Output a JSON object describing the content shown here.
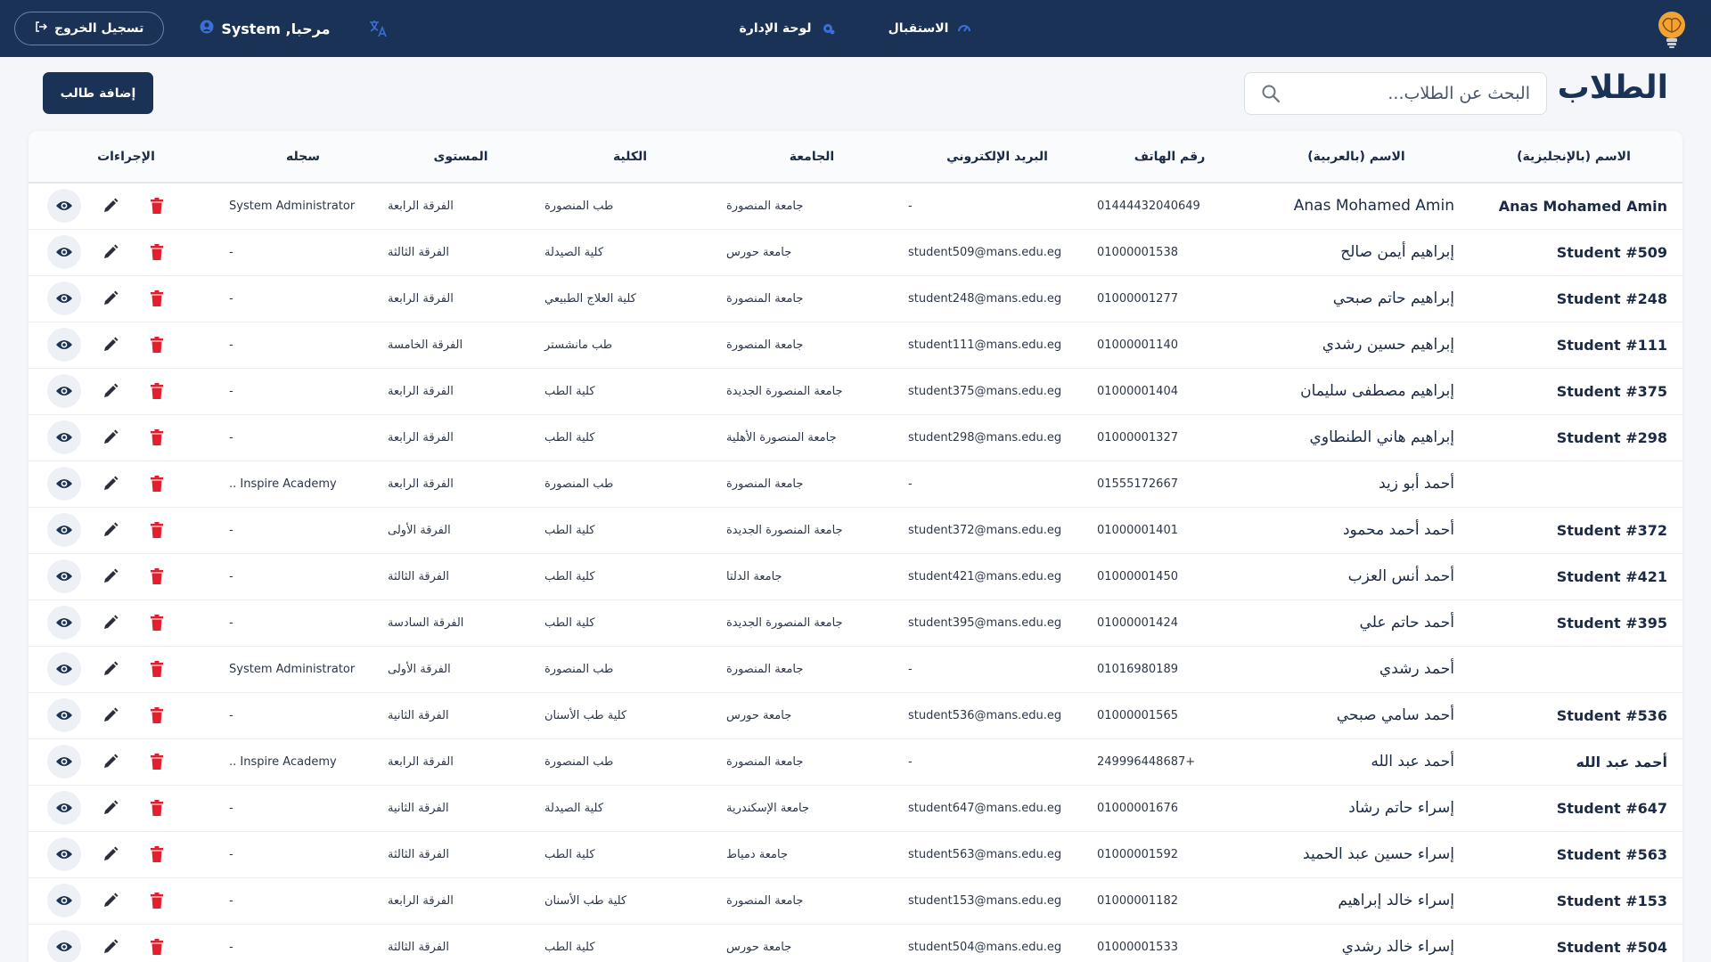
{
  "nav": {
    "home": "الاستقبال",
    "dashboard": "لوحة الإدارة",
    "welcome": "مرحبا, System",
    "logout": "تسجيل الخروج"
  },
  "page": {
    "title": "الطلاب",
    "search_placeholder": "البحث عن الطلاب...",
    "add_label": "إضافة طالب"
  },
  "table": {
    "headers": {
      "name_en": "الاسم (بالإنجليزية)",
      "name_ar": "الاسم (بالعربية)",
      "phone": "رقم الهاتف",
      "email": "البريد الإلكتروني",
      "university": "الجامعة",
      "faculty": "الكلية",
      "level": "المستوى",
      "record": "سجله",
      "actions": "الإجراءات"
    },
    "rows": [
      {
        "name_en": "Anas Mohamed Amin",
        "name_ar": "Anas Mohamed Amin",
        "phone": "01444432040649",
        "email": "-",
        "university": "جامعة المنصورة",
        "faculty": "طب المنصورة",
        "level": "الفرقة الرابعة",
        "record": "System Administrator"
      },
      {
        "name_en": "Student #509",
        "name_ar": "إبراهيم أيمن صالح",
        "phone": "01000001538",
        "email": "student509@mans.edu.eg",
        "university": "جامعة حورس",
        "faculty": "كلية الصيدلة",
        "level": "الفرقة الثالثة",
        "record": "-"
      },
      {
        "name_en": "Student #248",
        "name_ar": "إبراهيم حاتم صبحي",
        "phone": "01000001277",
        "email": "student248@mans.edu.eg",
        "university": "جامعة المنصورة",
        "faculty": "كلية العلاج الطبيعي",
        "level": "الفرقة الرابعة",
        "record": "-"
      },
      {
        "name_en": "Student #111",
        "name_ar": "إبراهيم حسين رشدي",
        "phone": "01000001140",
        "email": "student111@mans.edu.eg",
        "university": "جامعة المنصورة",
        "faculty": "طب مانشستر",
        "level": "الفرقة الخامسة",
        "record": "-"
      },
      {
        "name_en": "Student #375",
        "name_ar": "إبراهيم مصطفى سليمان",
        "phone": "01000001404",
        "email": "student375@mans.edu.eg",
        "university": "جامعة المنصورة الجديدة",
        "faculty": "كلية الطب",
        "level": "الفرقة الرابعة",
        "record": "-"
      },
      {
        "name_en": "Student #298",
        "name_ar": "إبراهيم هاني الطنطاوي",
        "phone": "01000001327",
        "email": "student298@mans.edu.eg",
        "university": "جامعة المنصورة الأهلية",
        "faculty": "كلية الطب",
        "level": "الفرقة الرابعة",
        "record": "-"
      },
      {
        "name_en": "",
        "name_ar": "أحمد أبو زيد",
        "phone": "01555172667",
        "email": "-",
        "university": "جامعة المنصورة",
        "faculty": "طب المنصورة",
        "level": "الفرقة الرابعة",
        "record": "Inspire Academy .."
      },
      {
        "name_en": "Student #372",
        "name_ar": "أحمد أحمد محمود",
        "phone": "01000001401",
        "email": "student372@mans.edu.eg",
        "university": "جامعة المنصورة الجديدة",
        "faculty": "كلية الطب",
        "level": "الفرقة الأولى",
        "record": "-"
      },
      {
        "name_en": "Student #421",
        "name_ar": "أحمد أنس العزب",
        "phone": "01000001450",
        "email": "student421@mans.edu.eg",
        "university": "جامعة الدلتا",
        "faculty": "كلية الطب",
        "level": "الفرقة الثالثة",
        "record": "-"
      },
      {
        "name_en": "Student #395",
        "name_ar": "أحمد حاتم علي",
        "phone": "01000001424",
        "email": "student395@mans.edu.eg",
        "university": "جامعة المنصورة الجديدة",
        "faculty": "كلية الطب",
        "level": "الفرقة السادسة",
        "record": "-"
      },
      {
        "name_en": "",
        "name_ar": "أحمد رشدي",
        "phone": "01016980189",
        "email": "-",
        "university": "جامعة المنصورة",
        "faculty": "طب المنصورة",
        "level": "الفرقة الأولى",
        "record": "System Administrator"
      },
      {
        "name_en": "Student #536",
        "name_ar": "أحمد سامي صبحي",
        "phone": "01000001565",
        "email": "student536@mans.edu.eg",
        "university": "جامعة حورس",
        "faculty": "كلية طب الأسنان",
        "level": "الفرقة الثانية",
        "record": "-"
      },
      {
        "name_en": "أحمد عبد الله",
        "name_ar": "أحمد عبد الله",
        "phone": "+249996448687",
        "email": "-",
        "university": "جامعة المنصورة",
        "faculty": "طب المنصورة",
        "level": "الفرقة الرابعة",
        "record": "Inspire Academy .."
      },
      {
        "name_en": "Student #647",
        "name_ar": "إسراء حاتم رشاد",
        "phone": "01000001676",
        "email": "student647@mans.edu.eg",
        "university": "جامعة الإسكندرية",
        "faculty": "كلية الصيدلة",
        "level": "الفرقة الثانية",
        "record": "-"
      },
      {
        "name_en": "Student #563",
        "name_ar": "إسراء حسين عبد الحميد",
        "phone": "01000001592",
        "email": "student563@mans.edu.eg",
        "university": "جامعة دمياط",
        "faculty": "كلية الطب",
        "level": "الفرقة الثالثة",
        "record": "-"
      },
      {
        "name_en": "Student #153",
        "name_ar": "إسراء خالد إبراهيم",
        "phone": "01000001182",
        "email": "student153@mans.edu.eg",
        "university": "جامعة المنصورة",
        "faculty": "كلية طب الأسنان",
        "level": "الفرقة الرابعة",
        "record": "-"
      },
      {
        "name_en": "Student #504",
        "name_ar": "إسراء خالد رشدي",
        "phone": "01000001533",
        "email": "student504@mans.edu.eg",
        "university": "جامعة حورس",
        "faculty": "كلية الطب",
        "level": "الفرقة الثالثة",
        "record": "-"
      }
    ]
  },
  "icons": {
    "logo": "brain-lightbulb-icon",
    "home": "gauge-icon",
    "dashboard": "gear-icon",
    "user": "user-circle-icon",
    "logout": "logout-icon",
    "language": "translate-icon",
    "search": "search-icon",
    "view": "eye-icon",
    "edit": "pencil-icon",
    "delete": "trash-icon"
  },
  "colors": {
    "navbar": "#1a3256",
    "accent_blue": "#3b6fd8",
    "danger": "#e0202e",
    "primary_button": "#1a3256"
  }
}
